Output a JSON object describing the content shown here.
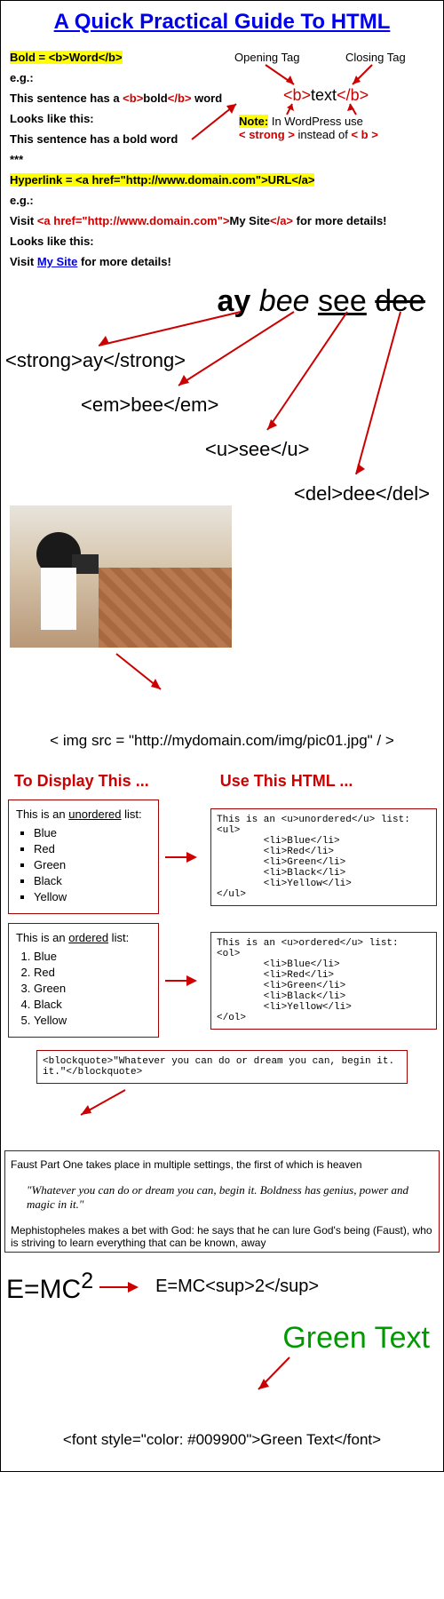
{
  "title": "A Quick Practical Guide To HTML",
  "bold_rule": "Bold = <b>Word</b>",
  "eg": "e.g.:",
  "bold_example_pre": "This sentence has a ",
  "bold_example_open": "<b>",
  "bold_example_word": "bold",
  "bold_example_close": "</b>",
  "bold_example_post": " word",
  "looks_like": "Looks like this:",
  "bold_rendered_pre": "This sentence has a ",
  "bold_rendered_word": "bold",
  "bold_rendered_post": " word",
  "stars": "***",
  "opening_tag": "Opening Tag",
  "closing_tag": "Closing Tag",
  "tag_demo_open": "<b>",
  "tag_demo_text": "text",
  "tag_demo_close": "</b>",
  "note_label": "Note:",
  "note_text": " In WordPress use",
  "note_strong": "< strong >",
  "note_instead": " instead of ",
  "note_b": "< b >",
  "hyperlink_rule": "Hyperlink = <a href=\"http://www.domain.com\">URL</a>",
  "link_ex_pre": "Visit ",
  "link_ex_open": "<a href=\"http://www.domain.com\">",
  "link_ex_text": "My Site",
  "link_ex_close": "</a>",
  "link_ex_post": " for more details!",
  "link_rendered_pre": "Visit ",
  "link_rendered_text": "My Site",
  "link_rendered_post": " for more details!",
  "style_words": {
    "ay": "ay",
    "bee": "bee",
    "see": "see",
    "dee": "dee"
  },
  "tag_strong": "<strong>ay</strong>",
  "tag_em": "<em>bee</em>",
  "tag_u": "<u>see</u>",
  "tag_del": "<del>dee</del>",
  "img_tag": "< img src = \"http://mydomain.com/img/pic01.jpg\" / >",
  "col_left": "To Display This ...",
  "col_right": "Use This HTML ...",
  "ul_intro_pre": "This is an ",
  "ul_intro_word": "unordered",
  "ul_intro_post": " list:",
  "ol_intro_pre": "This is an ",
  "ol_intro_word": "ordered",
  "ol_intro_post": " list:",
  "colors": [
    "Blue",
    "Red",
    "Green",
    "Black",
    "Yellow"
  ],
  "ul_code": "This is an <u>unordered</u> list:\n<ul>\n        <li>Blue</li>\n        <li>Red</li>\n        <li>Green</li>\n        <li>Black</li>\n        <li>Yellow</li>\n</ul>",
  "ol_code": "This is an <u>ordered</u> list:\n<ol>\n        <li>Blue</li>\n        <li>Red</li>\n        <li>Green</li>\n        <li>Black</li>\n        <li>Yellow</li>\n</ol>",
  "bq_code": "<blockquote>\"Whatever you can do or dream you can, begin it. it.\"</blockquote>",
  "faust_intro": "Faust Part One takes place in multiple settings, the first of which is heaven",
  "faust_quote": "\"Whatever you can do or dream you can, begin it. Boldness has genius, power and magic in it.\"",
  "faust_outro": "Mephistopheles makes a bet with God: he says that he can lure God's being (Faust), who is striving to learn everything that can be known, away",
  "emc_display": "E=MC",
  "emc_sup": "2",
  "emc_code": "E=MC<sup>2</sup>",
  "green_text": "Green Text",
  "font_code": "<font style=\"color: #009900\">Green Text</font>"
}
